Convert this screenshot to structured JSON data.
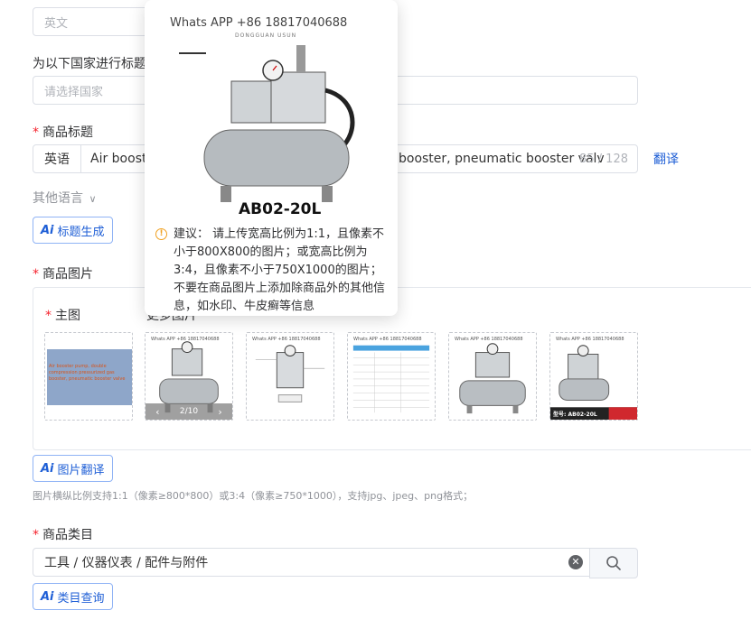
{
  "language_field": {
    "placeholder": "英文"
  },
  "country_section": {
    "label": "为以下国家进行标题",
    "placeholder": "请选择国家"
  },
  "title_section": {
    "label": "商品标题",
    "lang_tag": "英语",
    "value_left": "Air booste",
    "value_right": "booster, pneumatic booster valv",
    "count": "85 / 128",
    "translate_link": "翻译"
  },
  "other_lang": {
    "label": "其他语言"
  },
  "ai_title_button": {
    "label": "标题生成"
  },
  "images_section": {
    "label": "商品图片",
    "main_label": "主图",
    "detail_label": "更多图片",
    "thumbs": [
      {
        "text": "Air booster pump, double compression pressurized gas booster, pneumatic booster valve"
      },
      {
        "header": "Whats APP +86 18817040688"
      },
      {
        "header": "Whats APP +86 18817040688"
      },
      {
        "header": "Whats APP +86 18817040688"
      },
      {
        "header": "Whats APP +86 18817040688"
      },
      {
        "header": "Whats APP +86 18817040688",
        "label": "型号: AB02-20L"
      }
    ],
    "thumb_controls": {
      "page": "2/10"
    },
    "hint": "图片横纵比例支持1:1（像素≥800*800）或3:4（像素≥750*1000），支持jpg、jpeg、png格式；"
  },
  "ai_image_button": {
    "label": "图片翻译"
  },
  "category_section": {
    "label": "商品类目",
    "value": "工具 / 仪器仪表 / 配件与附件"
  },
  "ai_category_button": {
    "label": "类目查询"
  },
  "popover": {
    "header": "Whats APP +86 18817040688",
    "subheader": "DONGGUAN USUN",
    "model": "AB02-20L",
    "advice": "建议： 请上传宽高比例为1:1，且像素不小于800X800的图片；或宽高比例为3:4，且像素不小于750X1000的图片；不要在商品图片上添加除商品外的其他信息，如水印、牛皮癣等信息"
  },
  "colors": {
    "accent": "#1f5fd6",
    "required": "#f5222d",
    "border": "#dcdfe6"
  }
}
